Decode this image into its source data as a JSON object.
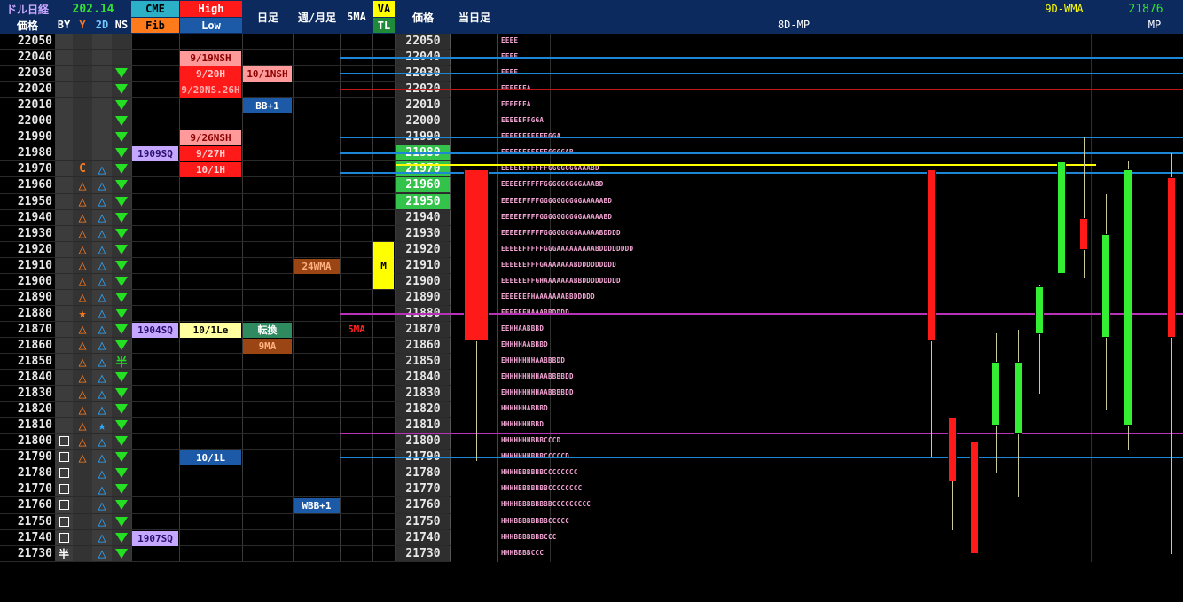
{
  "header": {
    "title": "ドル日経",
    "price_label": "価格",
    "value": "202.14",
    "by_label": "BY",
    "y_label": "Y",
    "d2_label": "2D",
    "ns_label": "NS",
    "cme_label": "CME",
    "fib_label": "Fib",
    "high_label": "High",
    "low_label": "Low",
    "daily_label": "日足",
    "weekly_label": "週/月足",
    "ma5_label": "5MA",
    "va_label": "VA",
    "tl_label": "TL",
    "price_label2": "価格",
    "today_label": "当日足",
    "mp8d_label": "8D-MP",
    "wma_label": "9D-WMA",
    "mp_value": "21876",
    "mp_label": "MP"
  },
  "rows": [
    {
      "price": "22050",
      "by": "",
      "y": "",
      "d2": "",
      "ns": "",
      "cme": "",
      "hl": "",
      "daily": "",
      "weekly": "",
      "ma5": "",
      "va": "",
      "mp": "EEEE"
    },
    {
      "price": "22040",
      "by": "",
      "y": "",
      "d2": "",
      "ns": "",
      "cme": "",
      "hl": "9/19NSH",
      "daily": "",
      "weekly": "",
      "ma5": "",
      "va": "",
      "mp": "EEEE"
    },
    {
      "price": "22030",
      "by": "",
      "y": "",
      "d2": "",
      "ns": "down",
      "cme": "",
      "hl": "9/20H",
      "daily": "10/1NSH",
      "weekly": "",
      "ma5": "",
      "va": "",
      "mp": "EEEE"
    },
    {
      "price": "22020",
      "by": "",
      "y": "",
      "d2": "",
      "ns": "down",
      "cme": "",
      "hl": "9/20NS.26H",
      "daily": "",
      "weekly": "",
      "ma5": "",
      "va": "",
      "mp": "EEEEFFA"
    },
    {
      "price": "22010",
      "by": "",
      "y": "",
      "d2": "",
      "ns": "down",
      "cme": "",
      "hl": "",
      "daily": "BB+1",
      "weekly": "",
      "ma5": "",
      "va": "",
      "mp": "EEEEEFA"
    },
    {
      "price": "22000",
      "by": "",
      "y": "",
      "d2": "",
      "ns": "down",
      "cme": "",
      "hl": "",
      "daily": "",
      "weekly": "",
      "ma5": "",
      "va": "",
      "mp": "EEEEEFFGGA"
    },
    {
      "price": "21990",
      "by": "",
      "y": "",
      "d2": "",
      "ns": "down",
      "cme": "",
      "hl": "9/26NSH",
      "daily": "",
      "weekly": "",
      "ma5": "",
      "va": "",
      "mp": "EEEEEFFFFFFGGA"
    },
    {
      "price": "21980",
      "by": "",
      "y": "",
      "d2": "",
      "ns": "down",
      "cme": "1909SQ",
      "hl": "9/27H",
      "daily": "",
      "weekly": "",
      "ma5": "",
      "va": "",
      "mp": "EEEEEFFFFFFGGGGAB"
    },
    {
      "price": "21970",
      "by": "",
      "y": "C",
      "d2": "tri",
      "ns": "down",
      "cme": "",
      "hl": "10/1H",
      "daily": "",
      "weekly": "",
      "ma5": "",
      "va": "",
      "mp": "EEEEEFFFFFFGGGGGGGAAABD"
    },
    {
      "price": "21960",
      "by": "",
      "y": "tri",
      "d2": "tri",
      "ns": "down",
      "cme": "",
      "hl": "",
      "daily": "",
      "weekly": "",
      "ma5": "",
      "va": "",
      "mp": "EEEEEFFFFFGGGGGGGGGAAABD"
    },
    {
      "price": "21950",
      "by": "",
      "y": "tri",
      "d2": "tri",
      "ns": "down",
      "cme": "",
      "hl": "",
      "daily": "",
      "weekly": "",
      "ma5": "",
      "va": "",
      "mp": "EEEEEFFFFGGGGGGGGGGAAAAABD"
    },
    {
      "price": "21940",
      "by": "",
      "y": "tri",
      "d2": "tri",
      "ns": "down",
      "cme": "",
      "hl": "",
      "daily": "",
      "weekly": "",
      "ma5": "",
      "va": "",
      "mp": "EEEEEFFFFGGGGGGGGGGAAAAABD"
    },
    {
      "price": "21930",
      "by": "",
      "y": "tri",
      "d2": "tri",
      "ns": "down",
      "cme": "",
      "hl": "",
      "daily": "",
      "weekly": "",
      "ma5": "",
      "va": "",
      "mp": "EEEEEFFFFFGGGGGGGGAAAAABDDDD"
    },
    {
      "price": "21920",
      "by": "",
      "y": "tri",
      "d2": "tri",
      "ns": "down",
      "cme": "",
      "hl": "",
      "daily": "",
      "weekly": "",
      "ma5": "",
      "va": "",
      "mp": "EEEEEFFFFFGGGAAAAAAAAABDDDDDDDD"
    },
    {
      "price": "21910",
      "by": "",
      "y": "tri",
      "d2": "tri",
      "ns": "down",
      "cme": "",
      "hl": "",
      "daily": "",
      "weekly": "24WMA",
      "ma5": "",
      "va": "M",
      "mp": "EEEEEEFFFGAAAAAAABDDDDDDDDD"
    },
    {
      "price": "21900",
      "by": "",
      "y": "tri",
      "d2": "tri",
      "ns": "down",
      "cme": "",
      "hl": "",
      "daily": "",
      "weekly": "",
      "ma5": "",
      "va": "",
      "mp": "EEEEEEFFGHAAAAAAABBDDDDDDDDD"
    },
    {
      "price": "21890",
      "by": "",
      "y": "tri",
      "d2": "tri",
      "ns": "down",
      "cme": "",
      "hl": "",
      "daily": "",
      "weekly": "",
      "ma5": "",
      "va": "",
      "mp": "EEEEEEFHAAAAAAABBDDDDD"
    },
    {
      "price": "21880",
      "by": "",
      "y": "star",
      "d2": "tri",
      "ns": "down",
      "cme": "",
      "hl": "",
      "daily": "",
      "weekly": "",
      "ma5": "",
      "va": "",
      "mp": "EEEEEFHAAABBDDDD"
    },
    {
      "price": "21870",
      "by": "",
      "y": "tri",
      "d2": "tri",
      "ns": "down",
      "cme": "1904SQ",
      "hl": "10/1Le",
      "daily": "転換",
      "weekly": "",
      "ma5": "5MA",
      "va": "",
      "mp": "EEHHAABBBD"
    },
    {
      "price": "21860",
      "by": "",
      "y": "tri",
      "d2": "tri",
      "ns": "down",
      "cme": "",
      "hl": "",
      "daily": "9MA",
      "weekly": "",
      "ma5": "",
      "va": "",
      "mp": "EHHHHAABBBD"
    },
    {
      "price": "21850",
      "by": "",
      "y": "tri",
      "d2": "tri",
      "ns": "半",
      "cme": "",
      "hl": "",
      "daily": "",
      "weekly": "",
      "ma5": "",
      "va": "",
      "mp": "EHHHHHHHAABBBDD"
    },
    {
      "price": "21840",
      "by": "",
      "y": "tri",
      "d2": "tri",
      "ns": "down",
      "cme": "",
      "hl": "",
      "daily": "",
      "weekly": "",
      "ma5": "",
      "va": "",
      "mp": "EHHHHHHHHAABBBBDD"
    },
    {
      "price": "21830",
      "by": "",
      "y": "tri",
      "d2": "tri",
      "ns": "down",
      "cme": "",
      "hl": "",
      "daily": "",
      "weekly": "",
      "ma5": "",
      "va": "",
      "mp": "EHHHHHHHHAABBBBDD"
    },
    {
      "price": "21820",
      "by": "",
      "y": "tri",
      "d2": "tri",
      "ns": "down",
      "cme": "",
      "hl": "",
      "daily": "",
      "weekly": "",
      "ma5": "",
      "va": "",
      "mp": "HHHHHHABBBD"
    },
    {
      "price": "21810",
      "by": "",
      "y": "tri",
      "d2": "star",
      "ns": "down",
      "cme": "",
      "hl": "",
      "daily": "",
      "weekly": "",
      "ma5": "",
      "va": "",
      "mp": "HHHHHHHBBD"
    },
    {
      "price": "21800",
      "by": "box",
      "y": "tri",
      "d2": "tri",
      "ns": "down",
      "cme": "",
      "hl": "",
      "daily": "",
      "weekly": "",
      "ma5": "",
      "va": "",
      "mp": "HHHHHHHBBBCCCD"
    },
    {
      "price": "21790",
      "by": "box",
      "y": "tri",
      "d2": "tri",
      "ns": "down",
      "cme": "",
      "hl": "10/1L",
      "daily": "",
      "weekly": "",
      "ma5": "",
      "va": "",
      "mp": "HHHHHHHBBBCCCCCD"
    },
    {
      "price": "21780",
      "by": "box",
      "y": "",
      "d2": "tri",
      "ns": "down",
      "cme": "",
      "hl": "",
      "daily": "",
      "weekly": "",
      "ma5": "",
      "va": "",
      "mp": "HHHHBBBBBBCCCCCCCC"
    },
    {
      "price": "21770",
      "by": "box",
      "y": "",
      "d2": "tri",
      "ns": "down",
      "cme": "",
      "hl": "",
      "daily": "",
      "weekly": "",
      "ma5": "",
      "va": "",
      "mp": "HHHHBBBBBBBCCCCCCCC"
    },
    {
      "price": "21760",
      "by": "box",
      "y": "",
      "d2": "tri",
      "ns": "down",
      "cme": "",
      "hl": "",
      "daily": "",
      "weekly": "WBB+1",
      "ma5": "",
      "va": "",
      "mp": "HHHHBBBBBBBBCCCCCCCCC"
    },
    {
      "price": "21750",
      "by": "box",
      "y": "",
      "d2": "tri",
      "ns": "down",
      "cme": "",
      "hl": "",
      "daily": "",
      "weekly": "",
      "ma5": "",
      "va": "",
      "mp": "HHHBBBBBBBBCCCCC"
    },
    {
      "price": "21740",
      "by": "box",
      "y": "",
      "d2": "tri",
      "ns": "down",
      "cme": "1907SQ",
      "hl": "",
      "daily": "",
      "weekly": "",
      "ma5": "",
      "va": "",
      "mp": "HHHBBBBBBBCCC"
    },
    {
      "price": "21730",
      "by": "半",
      "y": "",
      "d2": "tri",
      "ns": "down",
      "cme": "",
      "hl": "",
      "daily": "",
      "weekly": "",
      "ma5": "",
      "va": "",
      "mp": "HHHBBBBCCC"
    }
  ],
  "price2_highlight": {
    "21980": "#33c24a",
    "21970": "#33c24a",
    "21960": "#33c24a",
    "21950": "#33c24a"
  },
  "colors": {
    "down_triangle": "#23e023",
    "up_triangle": "#2fa9ff",
    "y_triangle": "#ff7a1a",
    "nsh_pink": "#ff9a9a",
    "red": "#ff1a1a",
    "blue_cell": "#1c5aa8",
    "lavender": "#c6a7ff",
    "brown": "#9a4513",
    "yellow": "#ffff00"
  },
  "chart_data": {
    "type": "candlestick",
    "x_axis": "sessions",
    "y_unit": "price",
    "candles": [
      {
        "open": 21970,
        "close": 21863,
        "high": 21970,
        "low": 21790,
        "color": "red",
        "pos": 0
      },
      {
        "open": 21815,
        "close": 21775,
        "high": 21815,
        "low": 21745,
        "color": "red",
        "pos": 1
      },
      {
        "open": 21800,
        "close": 21730,
        "high": 21805,
        "low": 21700,
        "color": "red",
        "pos": 2
      },
      {
        "open": 21810,
        "close": 21850,
        "high": 21868,
        "low": 21780,
        "color": "green",
        "pos": 3
      },
      {
        "open": 21805,
        "close": 21850,
        "high": 21870,
        "low": 21765,
        "color": "green",
        "pos": 4
      },
      {
        "open": 21867,
        "close": 21897,
        "high": 21898,
        "low": 21830,
        "color": "green",
        "pos": 5
      },
      {
        "open": 21905,
        "close": 21975,
        "high": 22050,
        "low": 21885,
        "color": "green",
        "pos": 6
      },
      {
        "open": 21940,
        "close": 21920,
        "high": 21990,
        "low": 21902,
        "color": "red",
        "pos": 7
      },
      {
        "open": 21865,
        "close": 21930,
        "high": 21955,
        "low": 21820,
        "color": "green",
        "pos": 8
      },
      {
        "open": 21810,
        "close": 21970,
        "high": 21975,
        "low": 21795,
        "color": "green",
        "pos": 9
      },
      {
        "open": 21965,
        "close": 21865,
        "high": 21980,
        "low": 21730,
        "color": "red",
        "pos": 10
      }
    ],
    "levels": [
      {
        "price": 22040,
        "color": "#1d86d6"
      },
      {
        "price": 22030,
        "color": "#1d86d6"
      },
      {
        "price": 22020,
        "color": "#c01818"
      },
      {
        "price": 21990,
        "color": "#1d86d6"
      },
      {
        "price": 21980,
        "color": "#1d86d6"
      },
      {
        "price": 21973,
        "color": "#ffff00"
      },
      {
        "price": 21968,
        "color": "#1d86d6"
      },
      {
        "price": 21880,
        "color": "#b832b8"
      },
      {
        "price": 21805,
        "color": "#b832b8"
      },
      {
        "price": 21790,
        "color": "#1d86d6"
      }
    ]
  }
}
